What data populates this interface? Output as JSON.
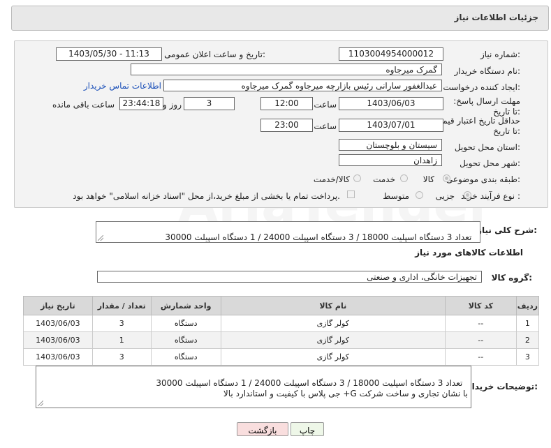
{
  "header": {
    "title": "جزئیات اطلاعات نیاز"
  },
  "form": {
    "need_number_label": "شماره نیاز:",
    "need_number": "1103004954000012",
    "announce_label": "تاریخ و ساعت اعلان عمومی:",
    "announce_value": "1403/05/30 - 11:13",
    "buyer_org_label": "نام دستگاه خریدار:",
    "buyer_org": "گمرک میرجاوه",
    "creator_label": "ایجاد کننده درخواست:",
    "creator": "عبدالغفور سارانی رئیس بازارچه میرجاوه گمرک میرجاوه",
    "contact_link": "اطلاعات تماس خریدار",
    "deadline_label": "مهلت ارسال پاسخ: تا تاریخ:",
    "deadline_date": "1403/06/03",
    "time_label": "ساعت",
    "deadline_time": "12:00",
    "days": "3",
    "days_label": "روز و",
    "remaining_time": "23:44:18",
    "remaining_label": "ساعت باقی مانده",
    "min_validity_label": "حداقل تاریخ اعتبار قیمت: تا تاریخ:",
    "validity_date": "1403/07/01",
    "validity_time": "23:00",
    "province_label": "استان محل تحویل:",
    "province": "سیستان و بلوچستان",
    "city_label": "شهر محل تحویل:",
    "city": "زاهدان",
    "category_label": "طبقه بندی موضوعی:",
    "category_options": [
      "کالا",
      "خدمت",
      "کالا/خدمت"
    ],
    "purchase_type_label": "نوع فرآیند خرید :",
    "purchase_options": [
      "جزیی",
      "متوسط"
    ],
    "payment_note": "پرداخت تمام یا بخشی از مبلغ خرید،از محل \"اسناد خزانه اسلامی\" خواهد بود."
  },
  "summary": {
    "label": "شرح کلی نیاز:",
    "text": "تعداد 3 دستگاه اسپلیت 18000 / 3 دستگاه اسپیلت 24000 / 1 دستگاه اسپیلت 30000"
  },
  "goods": {
    "section_title": "اطلاعات کالاهای مورد نیاز",
    "group_label": "گروه کالا:",
    "group_value": "تجهیزات خانگی، اداری و صنعتی",
    "columns": [
      "ردیف",
      "کد کالا",
      "نام کالا",
      "واحد شمارش",
      "تعداد / مقدار",
      "تاریخ نیاز"
    ],
    "rows": [
      [
        "1",
        "--",
        "کولر گازی",
        "دستگاه",
        "3",
        "1403/06/03"
      ],
      [
        "2",
        "--",
        "کولر گازی",
        "دستگاه",
        "1",
        "1403/06/03"
      ],
      [
        "3",
        "--",
        "کولر گازی",
        "دستگاه",
        "3",
        "1403/06/03"
      ]
    ]
  },
  "buyer_notes": {
    "label": "توضیحات خریدار:",
    "text": "تعداد 3 دستگاه اسپلیت 18000 / 3 دستگاه اسپیلت 24000 / 1 دستگاه اسپیلت 30000\nبا نشان تجاری و ساخت شرکت G+ جی پلاس با کیفیت و استاندارد بالا"
  },
  "buttons": {
    "print": "چاپ",
    "back": "بازگشت"
  },
  "colors": {
    "link": "#1a4fb8",
    "back_button": "#f9dede",
    "print_button": "#eef7e8"
  }
}
